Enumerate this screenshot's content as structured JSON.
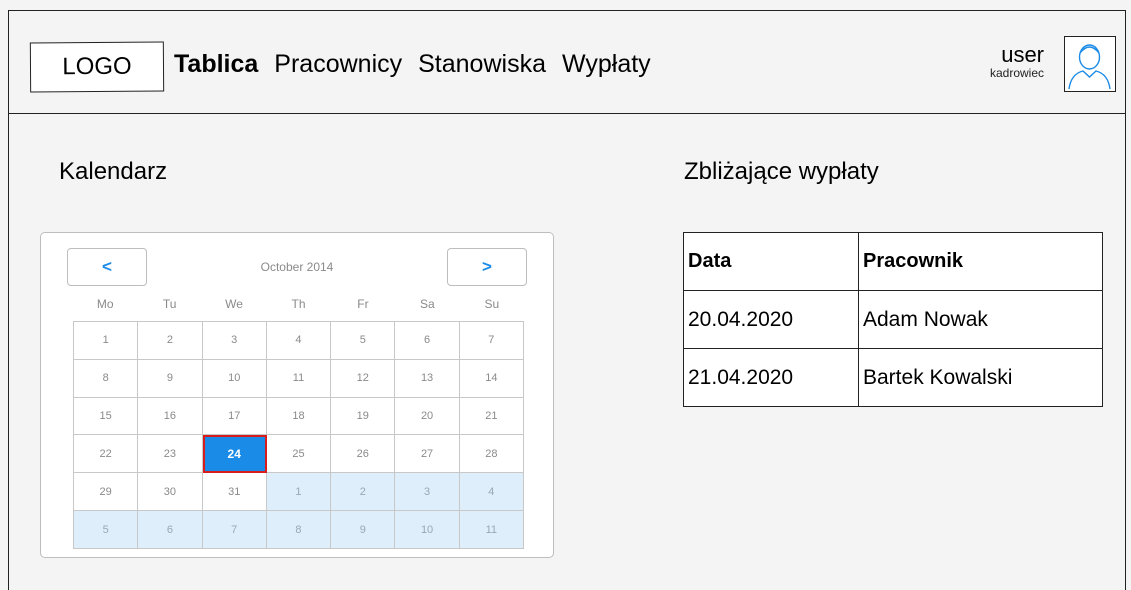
{
  "header": {
    "logo": "LOGO",
    "nav": [
      "Tablica",
      "Pracownicy",
      "Stanowiska",
      "Wypłaty"
    ],
    "user": {
      "name": "user",
      "role": "kadrowiec"
    }
  },
  "calendar": {
    "title": "Kalendarz",
    "prev_label": "<",
    "next_label": ">",
    "month": "October 2014",
    "weekdays": [
      "Mo",
      "Tu",
      "We",
      "Th",
      "Fr",
      "Sa",
      "Su"
    ],
    "selected_day": 24,
    "days": [
      [
        "1",
        "2",
        "3",
        "4",
        "5",
        "6",
        "7"
      ],
      [
        "8",
        "9",
        "10",
        "11",
        "12",
        "13",
        "14"
      ],
      [
        "15",
        "16",
        "17",
        "18",
        "19",
        "20",
        "21"
      ],
      [
        "22",
        "23",
        "24",
        "25",
        "26",
        "27",
        "28"
      ],
      [
        "29",
        "30",
        "31",
        "1",
        "2",
        "3",
        "4"
      ],
      [
        "5",
        "6",
        "7",
        "8",
        "9",
        "10",
        "11"
      ]
    ]
  },
  "payouts": {
    "title": "Zbliżające wypłaty",
    "columns": [
      "Data",
      "Pracownik"
    ],
    "rows": [
      [
        "20.04.2020",
        "Adam Nowak"
      ],
      [
        "21.04.2020",
        "Bartek Kowalski"
      ]
    ]
  }
}
